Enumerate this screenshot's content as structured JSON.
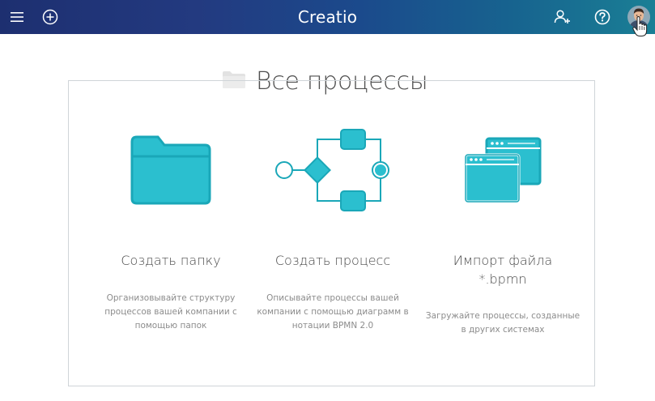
{
  "app": {
    "logo_text": "Creatio"
  },
  "header": {
    "icons": [
      "menu-icon",
      "add-icon",
      "add-user-icon",
      "help-icon",
      "avatar"
    ],
    "accent_colors": [
      "#1d2f70",
      "#1a7f95"
    ]
  },
  "page": {
    "title": "Все процессы",
    "title_icon": "folder-icon"
  },
  "options": [
    {
      "icon": "folder-illustration",
      "title": "Создать папку",
      "description": "Организовывайте структуру процессов вашей компании с помощью папок"
    },
    {
      "icon": "process-diagram-illustration",
      "title": "Создать процесс",
      "description": "Описывайте процессы вашей компании с помощью диаграмм в нотации BPMN 2.0"
    },
    {
      "icon": "import-windows-illustration",
      "title": "Импорт файла *.bpmn",
      "description": "Загружайте процессы, созданные в других системах"
    }
  ],
  "colors": {
    "illustration_fill": "#2bbfcf",
    "illustration_stroke": "#1aa7b8",
    "card_border": "#cfd4d8"
  }
}
